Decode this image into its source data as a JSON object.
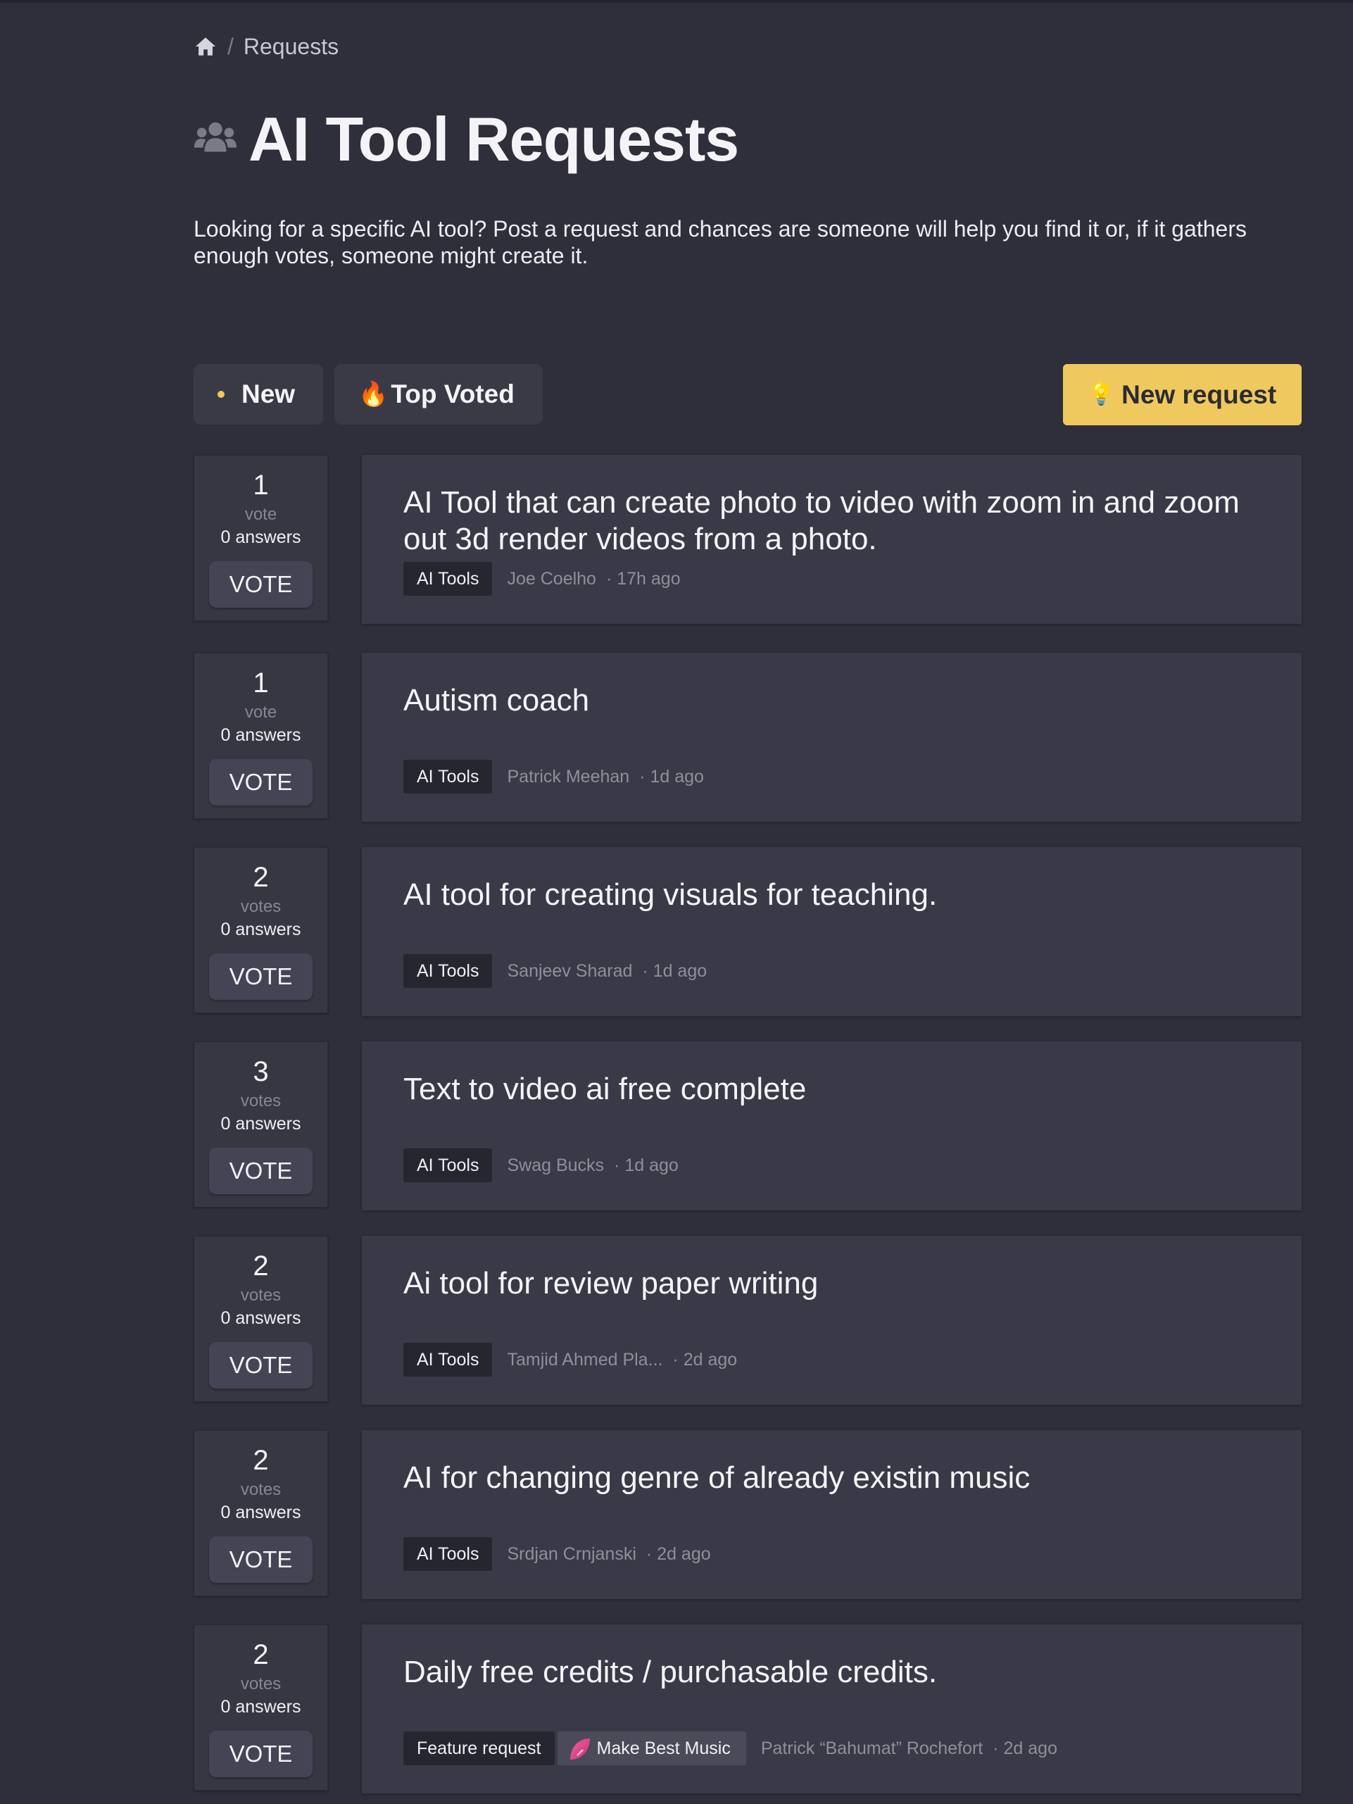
{
  "breadcrumb": {
    "home_icon": "home-icon",
    "separator": "/",
    "current": "Requests"
  },
  "header": {
    "icon": "users-icon",
    "title": "AI Tool Requests",
    "description": "Looking for a specific AI tool? Post a request and chances are someone will help you find it or, if it gathers enough votes, someone might create it."
  },
  "tabs": {
    "new_label": "New",
    "top_voted_label": "Top Voted",
    "top_voted_icon": "🔥"
  },
  "new_request": {
    "icon": "💡",
    "label": "New request"
  },
  "colors": {
    "background": "#2f2f3b",
    "card": "#393947",
    "accent": "#f0c95e"
  },
  "requests": [
    {
      "votes": "1",
      "vote_word": "vote",
      "answers": "0 answers",
      "vote_label": "VOTE",
      "title": "AI Tool that can create photo to video with zoom in and zoom out 3d render videos from a photo.",
      "tag": "AI Tools",
      "author": "Joe Coelho",
      "age": "· 17h ago"
    },
    {
      "votes": "1",
      "vote_word": "vote",
      "answers": "0 answers",
      "vote_label": "VOTE",
      "title": "Autism coach",
      "tag": "AI Tools",
      "author": "Patrick Meehan",
      "age": "· 1d ago"
    },
    {
      "votes": "2",
      "vote_word": "votes",
      "answers": "0 answers",
      "vote_label": "VOTE",
      "title": "AI tool for creating visuals for teaching.",
      "tag": "AI Tools",
      "author": "Sanjeev Sharad",
      "age": "· 1d ago"
    },
    {
      "votes": "3",
      "vote_word": "votes",
      "answers": "0 answers",
      "vote_label": "VOTE",
      "title": "Text to video ai free complete",
      "tag": "AI Tools",
      "author": "Swag Bucks",
      "age": "· 1d ago"
    },
    {
      "votes": "2",
      "vote_word": "votes",
      "answers": "0 answers",
      "vote_label": "VOTE",
      "title": "Ai tool for review paper writing",
      "tag": "AI Tools",
      "author": "Tamjid Ahmed Pla...",
      "age": "· 2d ago"
    },
    {
      "votes": "2",
      "vote_word": "votes",
      "answers": "0 answers",
      "vote_label": "VOTE",
      "title": "AI for changing genre of already existin music",
      "tag": "AI Tools",
      "author": "Srdjan Crnjanski",
      "age": "· 2d ago"
    },
    {
      "votes": "2",
      "vote_word": "votes",
      "answers": "0 answers",
      "vote_label": "VOTE",
      "title": "Daily free credits / purchasable credits.",
      "tag": "Feature request",
      "product_tag": "Make Best Music",
      "product_icon": "make-best-music-logo-icon",
      "author": "Patrick “Bahumat” Rochefort",
      "age": "· 2d ago"
    }
  ]
}
